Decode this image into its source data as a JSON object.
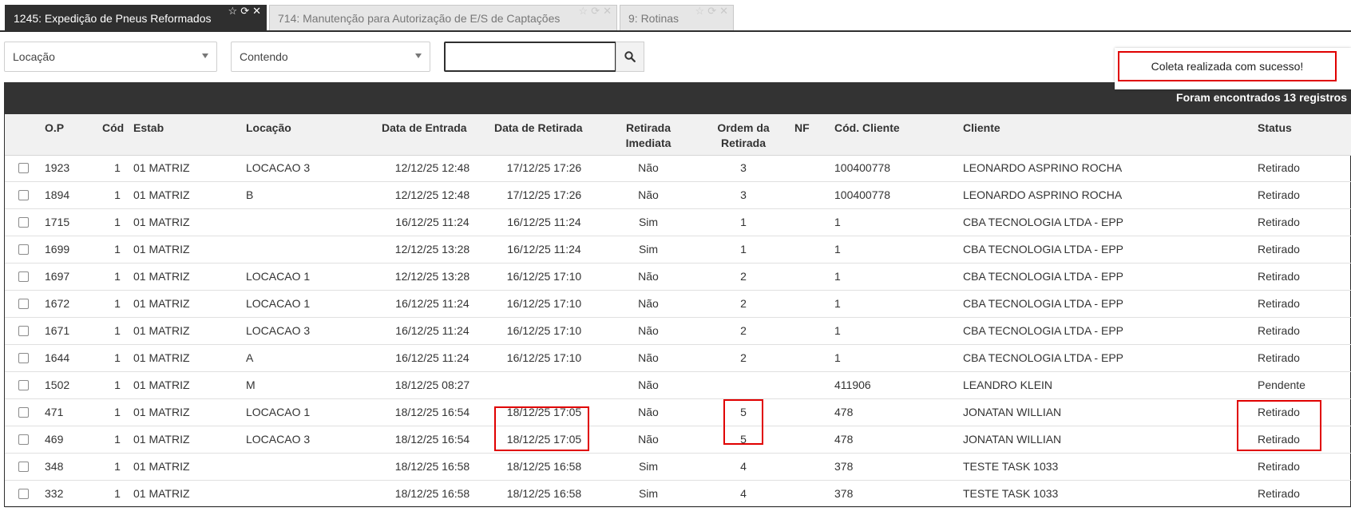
{
  "tabs": [
    {
      "label": "1245: Expedição de Pneus Reformados",
      "active": true
    },
    {
      "label": "714: Manutenção para Autorização de E/S de Captações",
      "active": false
    },
    {
      "label": "9: Rotinas",
      "active": false
    }
  ],
  "tab_icons": [
    "star-icon",
    "refresh-icon",
    "close-icon"
  ],
  "filters": {
    "field_select": "Locação",
    "operator_select": "Contendo",
    "search_value": ""
  },
  "toast": {
    "message": "Coleta realizada com sucesso!"
  },
  "grid": {
    "records_summary": "Foram encontrados 13 registros",
    "columns": {
      "op": "O.P",
      "cod": "Cód",
      "estab": "Estab",
      "locacao": "Locação",
      "data_entrada": "Data de Entrada",
      "data_retirada": "Data de Retirada",
      "retirada_imediata": "Retirada Imediata",
      "ordem_retirada": "Ordem da Retirada",
      "nf": "NF",
      "cod_cliente": "Cód. Cliente",
      "cliente": "Cliente",
      "status": "Status"
    },
    "rows": [
      {
        "op": "1923",
        "cod": "1",
        "estab": "01 MATRIZ",
        "locacao": "LOCACAO 3",
        "data_entrada": "12/12/25 12:48",
        "data_retirada": "17/12/25 17:26",
        "retirada_imediata": "Não",
        "ordem_retirada": "3",
        "nf": "",
        "cod_cliente": "100400778",
        "cliente": "LEONARDO ASPRINO ROCHA",
        "status": "Retirado"
      },
      {
        "op": "1894",
        "cod": "1",
        "estab": "01 MATRIZ",
        "locacao": "B",
        "data_entrada": "12/12/25 12:48",
        "data_retirada": "17/12/25 17:26",
        "retirada_imediata": "Não",
        "ordem_retirada": "3",
        "nf": "",
        "cod_cliente": "100400778",
        "cliente": "LEONARDO ASPRINO ROCHA",
        "status": "Retirado"
      },
      {
        "op": "1715",
        "cod": "1",
        "estab": "01 MATRIZ",
        "locacao": "",
        "data_entrada": "16/12/25 11:24",
        "data_retirada": "16/12/25 11:24",
        "retirada_imediata": "Sim",
        "ordem_retirada": "1",
        "nf": "",
        "cod_cliente": "1",
        "cliente": "CBA TECNOLOGIA LTDA - EPP",
        "status": "Retirado"
      },
      {
        "op": "1699",
        "cod": "1",
        "estab": "01 MATRIZ",
        "locacao": "",
        "data_entrada": "12/12/25 13:28",
        "data_retirada": "16/12/25 11:24",
        "retirada_imediata": "Sim",
        "ordem_retirada": "1",
        "nf": "",
        "cod_cliente": "1",
        "cliente": "CBA TECNOLOGIA LTDA - EPP",
        "status": "Retirado"
      },
      {
        "op": "1697",
        "cod": "1",
        "estab": "01 MATRIZ",
        "locacao": "LOCACAO 1",
        "data_entrada": "12/12/25 13:28",
        "data_retirada": "16/12/25 17:10",
        "retirada_imediata": "Não",
        "ordem_retirada": "2",
        "nf": "",
        "cod_cliente": "1",
        "cliente": "CBA TECNOLOGIA LTDA - EPP",
        "status": "Retirado"
      },
      {
        "op": "1672",
        "cod": "1",
        "estab": "01 MATRIZ",
        "locacao": "LOCACAO 1",
        "data_entrada": "16/12/25 11:24",
        "data_retirada": "16/12/25 17:10",
        "retirada_imediata": "Não",
        "ordem_retirada": "2",
        "nf": "",
        "cod_cliente": "1",
        "cliente": "CBA TECNOLOGIA LTDA - EPP",
        "status": "Retirado"
      },
      {
        "op": "1671",
        "cod": "1",
        "estab": "01 MATRIZ",
        "locacao": "LOCACAO 3",
        "data_entrada": "16/12/25 11:24",
        "data_retirada": "16/12/25 17:10",
        "retirada_imediata": "Não",
        "ordem_retirada": "2",
        "nf": "",
        "cod_cliente": "1",
        "cliente": "CBA TECNOLOGIA LTDA - EPP",
        "status": "Retirado"
      },
      {
        "op": "1644",
        "cod": "1",
        "estab": "01 MATRIZ",
        "locacao": "A",
        "data_entrada": "16/12/25 11:24",
        "data_retirada": "16/12/25 17:10",
        "retirada_imediata": "Não",
        "ordem_retirada": "2",
        "nf": "",
        "cod_cliente": "1",
        "cliente": "CBA TECNOLOGIA LTDA - EPP",
        "status": "Retirado"
      },
      {
        "op": "1502",
        "cod": "1",
        "estab": "01 MATRIZ",
        "locacao": "M",
        "data_entrada": "18/12/25 08:27",
        "data_retirada": "",
        "retirada_imediata": "Não",
        "ordem_retirada": "",
        "nf": "",
        "cod_cliente": "411906",
        "cliente": "LEANDRO KLEIN",
        "status": "Pendente"
      },
      {
        "op": "471",
        "cod": "1",
        "estab": "01 MATRIZ",
        "locacao": "LOCACAO 1",
        "data_entrada": "18/12/25 16:54",
        "data_retirada": "18/12/25 17:05",
        "retirada_imediata": "Não",
        "ordem_retirada": "5",
        "nf": "",
        "cod_cliente": "478",
        "cliente": "JONATAN WILLIAN",
        "status": "Retirado"
      },
      {
        "op": "469",
        "cod": "1",
        "estab": "01 MATRIZ",
        "locacao": "LOCACAO 3",
        "data_entrada": "18/12/25 16:54",
        "data_retirada": "18/12/25 17:05",
        "retirada_imediata": "Não",
        "ordem_retirada": "5",
        "nf": "",
        "cod_cliente": "478",
        "cliente": "JONATAN WILLIAN",
        "status": "Retirado"
      },
      {
        "op": "348",
        "cod": "1",
        "estab": "01 MATRIZ",
        "locacao": "",
        "data_entrada": "18/12/25 16:58",
        "data_retirada": "18/12/25 16:58",
        "retirada_imediata": "Sim",
        "ordem_retirada": "4",
        "nf": "",
        "cod_cliente": "378",
        "cliente": "TESTE TASK 1033",
        "status": "Retirado"
      },
      {
        "op": "332",
        "cod": "1",
        "estab": "01 MATRIZ",
        "locacao": "",
        "data_entrada": "18/12/25 16:58",
        "data_retirada": "18/12/25 16:58",
        "retirada_imediata": "Sim",
        "ordem_retirada": "4",
        "nf": "",
        "cod_cliente": "378",
        "cliente": "TESTE TASK 1033",
        "status": "Retirado"
      }
    ]
  },
  "colors": {
    "dark": "#333333",
    "highlight": "#e00000"
  }
}
